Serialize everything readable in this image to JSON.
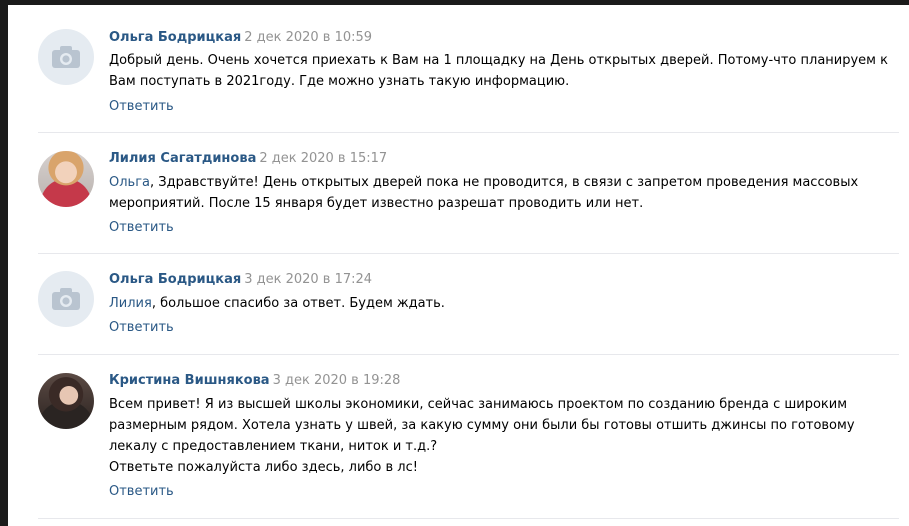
{
  "reply_label": "Ответить",
  "colors": {
    "link": "#2a5885",
    "date": "#939393",
    "text": "#000000",
    "divider": "#e7e8ec"
  },
  "comments": [
    {
      "author": "Ольга Бодрицкая",
      "date": "2 дек 2020 в 10:59",
      "avatar": "camera-placeholder-icon",
      "lines": [
        "Добрый день. Очень хочется приехать к Вам на 1 площадку на День открытых дверей. Потому-что планируем к",
        "Вам поступать в 2021году. Где можно узнать такую информацию."
      ]
    },
    {
      "author": "Лилия Сагатдинова",
      "date": "2 дек 2020 в 15:17",
      "avatar": "user-photo",
      "mention": "Ольга",
      "lines": [
        ", Здравствуйте! День открытых дверей пока не проводится, в связи с запретом проведения массовых",
        "мероприятий. После 15 января будет известно разрешат проводить или нет."
      ]
    },
    {
      "author": "Ольга Бодрицкая",
      "date": "3 дек 2020 в 17:24",
      "avatar": "camera-placeholder-icon",
      "mention": "Лилия",
      "lines": [
        ", большое спасибо за ответ. Будем ждать."
      ]
    },
    {
      "author": "Кристина Вишнякова",
      "date": "3 дек 2020 в 19:28",
      "avatar": "user-photo",
      "lines": [
        "Всем привет! Я из высшей школы экономики, сейчас занимаюсь проектом по созданию бренда с широким",
        "размерным рядом. Хотела узнать у швей, за какую сумму они были бы готовы отшить джинсы по готовому",
        "лекалу с предоставлением ткани, ниток и т.д.?",
        "Ответьте пожалуйста либо здесь, либо в лс!"
      ]
    }
  ]
}
